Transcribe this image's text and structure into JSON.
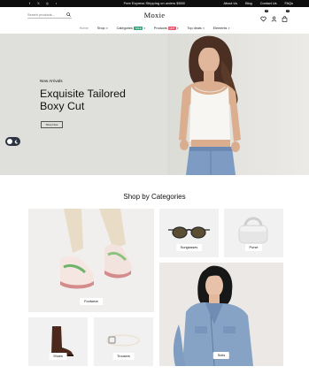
{
  "topbar": {
    "promo": "Free Express Shipping on orders $500!",
    "links": [
      "About Us",
      "Blog",
      "Contact Us",
      "FAQs"
    ],
    "socials": [
      "facebook-icon",
      "x-icon",
      "instagram-icon",
      "tiktok-icon"
    ]
  },
  "header": {
    "logo": "Moxie",
    "search_placeholder": "Search products...",
    "wishlist_count": "0",
    "cart_count": "0"
  },
  "nav": [
    {
      "label": "Home",
      "active": true,
      "caret": false,
      "tag": ""
    },
    {
      "label": "Shop",
      "active": false,
      "caret": true,
      "tag": ""
    },
    {
      "label": "Categories",
      "active": false,
      "caret": true,
      "tag": "SALE",
      "tag_color": "#3aa57a"
    },
    {
      "label": "Products",
      "active": false,
      "caret": true,
      "tag": "HOT",
      "tag_color": "#e4576d"
    },
    {
      "label": "Top deals",
      "active": false,
      "caret": true,
      "tag": ""
    },
    {
      "label": "Elements",
      "active": false,
      "caret": true,
      "tag": ""
    }
  ],
  "hero": {
    "eyebrow": "New Arrivals",
    "title_line1": "Exquisite Tailored",
    "title_line2": "Boxy Cut",
    "cta": "Shop Now"
  },
  "categories_section": {
    "title": "Shop by Categories",
    "items": {
      "footwear": "Footwear",
      "sunglasses": "Sunglasses",
      "purse": "Purse",
      "suits": "Suits",
      "shoes": "Shoes",
      "trousers": "Trousers"
    }
  },
  "colors": {
    "topbar_bg": "#0d0d0d",
    "hero_bg": "#dfdfdb",
    "card_bg": "#f1f1f1",
    "sale_tag": "#3aa57a",
    "hot_tag": "#e4576d"
  }
}
